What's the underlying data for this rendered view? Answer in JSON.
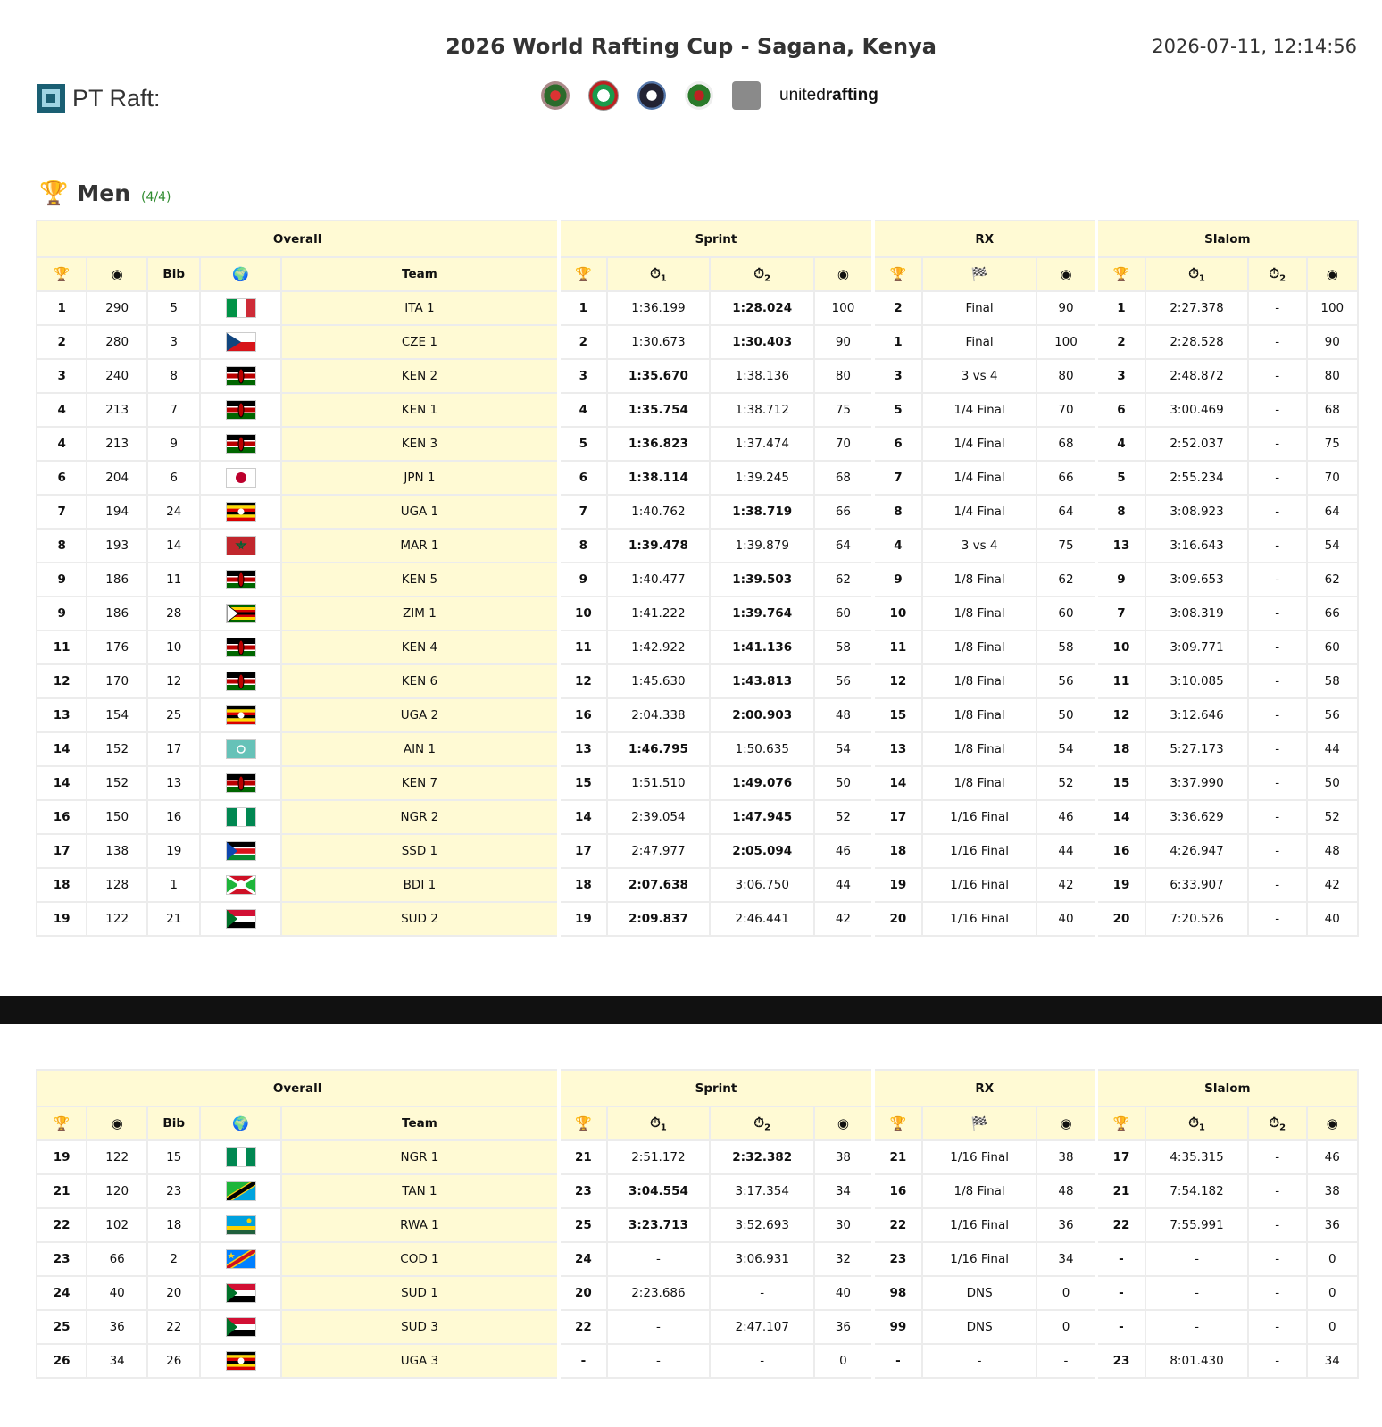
{
  "header": {
    "title": "2026 World Rafting Cup - Sagana, Kenya",
    "timestamp": "2026-07-11, 12:14:56",
    "brand": "PT Raft:",
    "sponsor_text_light": "united",
    "sponsor_text_bold": "rafting"
  },
  "section": {
    "title": "Men",
    "count": "(4/4)"
  },
  "groups": {
    "overall": "Overall",
    "sprint": "Sprint",
    "rx": "RX",
    "slalom": "Slalom"
  },
  "columns": {
    "bib": "Bib",
    "team": "Team",
    "sub1": "1",
    "sub2": "2"
  },
  "icons": {
    "rank": "trophy-icon",
    "points": "target-icon",
    "nation": "globe-icon",
    "time": "stopwatch-icon",
    "stage": "checkered-flag-icon"
  },
  "flags": {
    "ITA": [
      "#009246",
      "#ffffff",
      "#ce2b37",
      "v"
    ],
    "CZE": [
      "#ffffff",
      "#d7141a",
      "#11457e",
      "cz"
    ],
    "KEN": [
      "#000000",
      "#bb0000",
      "#006600",
      "ke"
    ],
    "JPN": [
      "#ffffff",
      "#bc002d",
      "#ffffff",
      "jp"
    ],
    "UGA": [
      "#000000",
      "#fcdc04",
      "#d90000",
      "ug"
    ],
    "MAR": [
      "#c1272d",
      "#006233",
      "#c1272d",
      "ma"
    ],
    "ZIM": [
      "#006400",
      "#ffd200",
      "#d40000",
      "zw"
    ],
    "AIN": [
      "#66c2b8",
      "#ffffff",
      "#66c2b8",
      "ain"
    ],
    "NGR": [
      "#008751",
      "#ffffff",
      "#008751",
      "v"
    ],
    "SSD": [
      "#000000",
      "#da121a",
      "#078930",
      "ss"
    ],
    "BDI": [
      "#ce1126",
      "#1eb53a",
      "#ffffff",
      "bi"
    ],
    "SUD": [
      "#d21034",
      "#ffffff",
      "#000000",
      "sd"
    ],
    "TAN": [
      "#1eb53a",
      "#000000",
      "#00a3dd",
      "tz"
    ],
    "RWA": [
      "#00a1de",
      "#fad201",
      "#20603d",
      "rw"
    ],
    "COD": [
      "#007fff",
      "#f7d618",
      "#ce1021",
      "cd"
    ]
  },
  "table1": [
    {
      "rank": "1",
      "pts": "290",
      "bib": "5",
      "nat": "ITA",
      "team": "ITA 1",
      "sr": "1",
      "s1": "1:36.199",
      "s2": "1:28.024",
      "best": 2,
      "sp": "100",
      "rr": "2",
      "rst": "Final",
      "rp": "90",
      "lr": "1",
      "l1": "2:27.378",
      "l2": "-",
      "lp": "100"
    },
    {
      "rank": "2",
      "pts": "280",
      "bib": "3",
      "nat": "CZE",
      "team": "CZE 1",
      "sr": "2",
      "s1": "1:30.673",
      "s2": "1:30.403",
      "best": 2,
      "sp": "90",
      "rr": "1",
      "rst": "Final",
      "rp": "100",
      "lr": "2",
      "l1": "2:28.528",
      "l2": "-",
      "lp": "90"
    },
    {
      "rank": "3",
      "pts": "240",
      "bib": "8",
      "nat": "KEN",
      "team": "KEN 2",
      "sr": "3",
      "s1": "1:35.670",
      "s2": "1:38.136",
      "best": 1,
      "sp": "80",
      "rr": "3",
      "rst": "3 vs 4",
      "rp": "80",
      "lr": "3",
      "l1": "2:48.872",
      "l2": "-",
      "lp": "80"
    },
    {
      "rank": "4",
      "pts": "213",
      "bib": "7",
      "nat": "KEN",
      "team": "KEN 1",
      "sr": "4",
      "s1": "1:35.754",
      "s2": "1:38.712",
      "best": 1,
      "sp": "75",
      "rr": "5",
      "rst": "1/4 Final",
      "rp": "70",
      "lr": "6",
      "l1": "3:00.469",
      "l2": "-",
      "lp": "68"
    },
    {
      "rank": "4",
      "pts": "213",
      "bib": "9",
      "nat": "KEN",
      "team": "KEN 3",
      "sr": "5",
      "s1": "1:36.823",
      "s2": "1:37.474",
      "best": 1,
      "sp": "70",
      "rr": "6",
      "rst": "1/4 Final",
      "rp": "68",
      "lr": "4",
      "l1": "2:52.037",
      "l2": "-",
      "lp": "75"
    },
    {
      "rank": "6",
      "pts": "204",
      "bib": "6",
      "nat": "JPN",
      "team": "JPN 1",
      "sr": "6",
      "s1": "1:38.114",
      "s2": "1:39.245",
      "best": 1,
      "sp": "68",
      "rr": "7",
      "rst": "1/4 Final",
      "rp": "66",
      "lr": "5",
      "l1": "2:55.234",
      "l2": "-",
      "lp": "70"
    },
    {
      "rank": "7",
      "pts": "194",
      "bib": "24",
      "nat": "UGA",
      "team": "UGA 1",
      "sr": "7",
      "s1": "1:40.762",
      "s2": "1:38.719",
      "best": 2,
      "sp": "66",
      "rr": "8",
      "rst": "1/4 Final",
      "rp": "64",
      "lr": "8",
      "l1": "3:08.923",
      "l2": "-",
      "lp": "64"
    },
    {
      "rank": "8",
      "pts": "193",
      "bib": "14",
      "nat": "MAR",
      "team": "MAR 1",
      "sr": "8",
      "s1": "1:39.478",
      "s2": "1:39.879",
      "best": 1,
      "sp": "64",
      "rr": "4",
      "rst": "3 vs 4",
      "rp": "75",
      "lr": "13",
      "l1": "3:16.643",
      "l2": "-",
      "lp": "54"
    },
    {
      "rank": "9",
      "pts": "186",
      "bib": "11",
      "nat": "KEN",
      "team": "KEN 5",
      "sr": "9",
      "s1": "1:40.477",
      "s2": "1:39.503",
      "best": 2,
      "sp": "62",
      "rr": "9",
      "rst": "1/8 Final",
      "rp": "62",
      "lr": "9",
      "l1": "3:09.653",
      "l2": "-",
      "lp": "62"
    },
    {
      "rank": "9",
      "pts": "186",
      "bib": "28",
      "nat": "ZIM",
      "team": "ZIM 1",
      "sr": "10",
      "s1": "1:41.222",
      "s2": "1:39.764",
      "best": 2,
      "sp": "60",
      "rr": "10",
      "rst": "1/8 Final",
      "rp": "60",
      "lr": "7",
      "l1": "3:08.319",
      "l2": "-",
      "lp": "66"
    },
    {
      "rank": "11",
      "pts": "176",
      "bib": "10",
      "nat": "KEN",
      "team": "KEN 4",
      "sr": "11",
      "s1": "1:42.922",
      "s2": "1:41.136",
      "best": 2,
      "sp": "58",
      "rr": "11",
      "rst": "1/8 Final",
      "rp": "58",
      "lr": "10",
      "l1": "3:09.771",
      "l2": "-",
      "lp": "60"
    },
    {
      "rank": "12",
      "pts": "170",
      "bib": "12",
      "nat": "KEN",
      "team": "KEN 6",
      "sr": "12",
      "s1": "1:45.630",
      "s2": "1:43.813",
      "best": 2,
      "sp": "56",
      "rr": "12",
      "rst": "1/8 Final",
      "rp": "56",
      "lr": "11",
      "l1": "3:10.085",
      "l2": "-",
      "lp": "58"
    },
    {
      "rank": "13",
      "pts": "154",
      "bib": "25",
      "nat": "UGA",
      "team": "UGA 2",
      "sr": "16",
      "s1": "2:04.338",
      "s2": "2:00.903",
      "best": 2,
      "sp": "48",
      "rr": "15",
      "rst": "1/8 Final",
      "rp": "50",
      "lr": "12",
      "l1": "3:12.646",
      "l2": "-",
      "lp": "56"
    },
    {
      "rank": "14",
      "pts": "152",
      "bib": "17",
      "nat": "AIN",
      "team": "AIN 1",
      "sr": "13",
      "s1": "1:46.795",
      "s2": "1:50.635",
      "best": 1,
      "sp": "54",
      "rr": "13",
      "rst": "1/8 Final",
      "rp": "54",
      "lr": "18",
      "l1": "5:27.173",
      "l2": "-",
      "lp": "44"
    },
    {
      "rank": "14",
      "pts": "152",
      "bib": "13",
      "nat": "KEN",
      "team": "KEN 7",
      "sr": "15",
      "s1": "1:51.510",
      "s2": "1:49.076",
      "best": 2,
      "sp": "50",
      "rr": "14",
      "rst": "1/8 Final",
      "rp": "52",
      "lr": "15",
      "l1": "3:37.990",
      "l2": "-",
      "lp": "50"
    },
    {
      "rank": "16",
      "pts": "150",
      "bib": "16",
      "nat": "NGR",
      "team": "NGR 2",
      "sr": "14",
      "s1": "2:39.054",
      "s2": "1:47.945",
      "best": 2,
      "sp": "52",
      "rr": "17",
      "rst": "1/16 Final",
      "rp": "46",
      "lr": "14",
      "l1": "3:36.629",
      "l2": "-",
      "lp": "52"
    },
    {
      "rank": "17",
      "pts": "138",
      "bib": "19",
      "nat": "SSD",
      "team": "SSD 1",
      "sr": "17",
      "s1": "2:47.977",
      "s2": "2:05.094",
      "best": 2,
      "sp": "46",
      "rr": "18",
      "rst": "1/16 Final",
      "rp": "44",
      "lr": "16",
      "l1": "4:26.947",
      "l2": "-",
      "lp": "48"
    },
    {
      "rank": "18",
      "pts": "128",
      "bib": "1",
      "nat": "BDI",
      "team": "BDI 1",
      "sr": "18",
      "s1": "2:07.638",
      "s2": "3:06.750",
      "best": 1,
      "sp": "44",
      "rr": "19",
      "rst": "1/16 Final",
      "rp": "42",
      "lr": "19",
      "l1": "6:33.907",
      "l2": "-",
      "lp": "42"
    },
    {
      "rank": "19",
      "pts": "122",
      "bib": "21",
      "nat": "SUD",
      "team": "SUD 2",
      "sr": "19",
      "s1": "2:09.837",
      "s2": "2:46.441",
      "best": 1,
      "sp": "42",
      "rr": "20",
      "rst": "1/16 Final",
      "rp": "40",
      "lr": "20",
      "l1": "7:20.526",
      "l2": "-",
      "lp": "40"
    }
  ],
  "table2": [
    {
      "rank": "19",
      "pts": "122",
      "bib": "15",
      "nat": "NGR",
      "team": "NGR 1",
      "sr": "21",
      "s1": "2:51.172",
      "s2": "2:32.382",
      "best": 2,
      "sp": "38",
      "rr": "21",
      "rst": "1/16 Final",
      "rp": "38",
      "lr": "17",
      "l1": "4:35.315",
      "l2": "-",
      "lp": "46"
    },
    {
      "rank": "21",
      "pts": "120",
      "bib": "23",
      "nat": "TAN",
      "team": "TAN 1",
      "sr": "23",
      "s1": "3:04.554",
      "s2": "3:17.354",
      "best": 1,
      "sp": "34",
      "rr": "16",
      "rst": "1/8 Final",
      "rp": "48",
      "lr": "21",
      "l1": "7:54.182",
      "l2": "-",
      "lp": "38"
    },
    {
      "rank": "22",
      "pts": "102",
      "bib": "18",
      "nat": "RWA",
      "team": "RWA 1",
      "sr": "25",
      "s1": "3:23.713",
      "s2": "3:52.693",
      "best": 1,
      "sp": "30",
      "rr": "22",
      "rst": "1/16 Final",
      "rp": "36",
      "lr": "22",
      "l1": "7:55.991",
      "l2": "-",
      "lp": "36"
    },
    {
      "rank": "23",
      "pts": "66",
      "bib": "2",
      "nat": "COD",
      "team": "COD 1",
      "sr": "24",
      "s1": "-",
      "s2": "3:06.931",
      "best": 0,
      "sp": "32",
      "rr": "23",
      "rst": "1/16 Final",
      "rp": "34",
      "lr": "-",
      "l1": "-",
      "l2": "-",
      "lp": "0"
    },
    {
      "rank": "24",
      "pts": "40",
      "bib": "20",
      "nat": "SUD",
      "team": "SUD 1",
      "sr": "20",
      "s1": "2:23.686",
      "s2": "-",
      "best": 0,
      "sp": "40",
      "rr": "98",
      "rst": "DNS",
      "rp": "0",
      "lr": "-",
      "l1": "-",
      "l2": "-",
      "lp": "0"
    },
    {
      "rank": "25",
      "pts": "36",
      "bib": "22",
      "nat": "SUD",
      "team": "SUD 3",
      "sr": "22",
      "s1": "-",
      "s2": "2:47.107",
      "best": 0,
      "sp": "36",
      "rr": "99",
      "rst": "DNS",
      "rp": "0",
      "lr": "-",
      "l1": "-",
      "l2": "-",
      "lp": "0"
    },
    {
      "rank": "26",
      "pts": "34",
      "bib": "26",
      "nat": "UGA",
      "team": "UGA 3",
      "sr": "-",
      "s1": "-",
      "s2": "-",
      "best": 0,
      "sp": "0",
      "rr": "-",
      "rst": "-",
      "rp": "-",
      "lr": "23",
      "l1": "8:01.430",
      "l2": "-",
      "lp": "34"
    }
  ]
}
